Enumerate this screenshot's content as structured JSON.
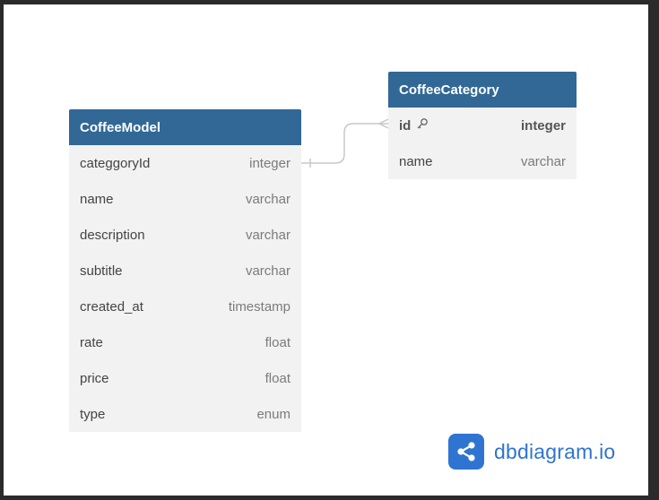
{
  "colors": {
    "header_bg": "#316896",
    "table_bg": "#f2f2f2",
    "brand": "#2f74d0"
  },
  "tables": {
    "coffee_model": {
      "name": "CoffeeModel",
      "fields": [
        {
          "name": "categgoryId",
          "type": "integer"
        },
        {
          "name": "name",
          "type": "varchar"
        },
        {
          "name": "description",
          "type": "varchar"
        },
        {
          "name": "subtitle",
          "type": "varchar"
        },
        {
          "name": "created_at",
          "type": "timestamp"
        },
        {
          "name": "rate",
          "type": "float"
        },
        {
          "name": "price",
          "type": "float"
        },
        {
          "name": "type",
          "type": "enum"
        }
      ]
    },
    "coffee_category": {
      "name": "CoffeeCategory",
      "fields": [
        {
          "name": "id",
          "type": "integer",
          "primary_key": true,
          "icon": "key-icon"
        },
        {
          "name": "name",
          "type": "varchar"
        }
      ]
    }
  },
  "relationship": {
    "from": "CoffeeModel.categgoryId",
    "to": "CoffeeCategory.id",
    "cardinality": "many-to-one"
  },
  "brand": {
    "text": "dbdiagram.io",
    "icon": "share-nodes-icon"
  }
}
